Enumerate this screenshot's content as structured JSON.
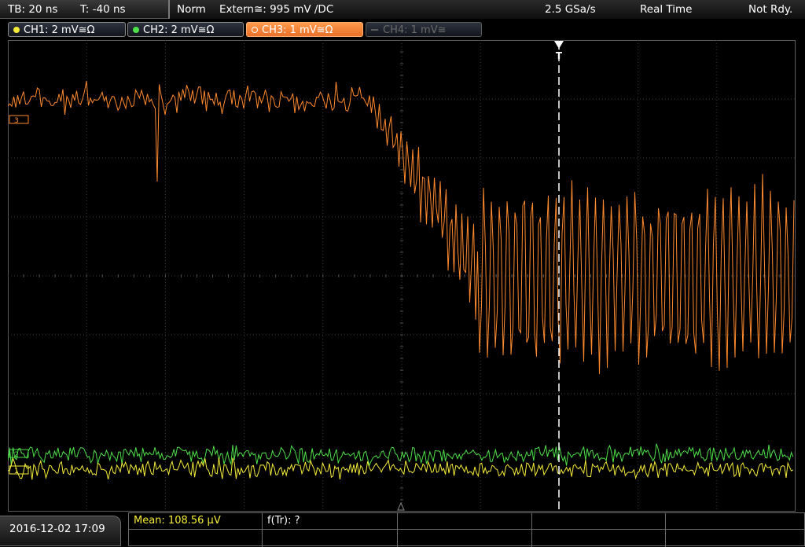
{
  "topbar": {
    "timebase": "TB: 20 ns",
    "trigger_offset": "T: -40 ns",
    "trigger_mode": "Norm",
    "trigger_source": "Extern≅: 995 mV ∕DC",
    "sample_rate": "2.5 GSa/s",
    "acq_mode": "Real Time",
    "status": "Not Rdy."
  },
  "channels": [
    {
      "label": "CH1: 2 mV≅Ω",
      "color": "#f5ec3a",
      "active": true
    },
    {
      "label": "CH2: 2 mV≅Ω",
      "color": "#4ee04a",
      "active": true
    },
    {
      "label": "CH3: 1 mV≅Ω",
      "color": "#f08a3c",
      "active": true
    },
    {
      "label": "CH4: 1 mV≅",
      "color": "#6a6a6a",
      "active": false
    }
  ],
  "markers": {
    "ch3": "3",
    "ch2": "2",
    "ch1": "1",
    "trigger": "T"
  },
  "bottom": {
    "datetime": "2016-12-02 17:09",
    "mean": "Mean: 108.56 µV",
    "ftr": "f(Tr): ?"
  },
  "colors": {
    "ch1": "#f5ec3a",
    "ch2": "#4ee04a",
    "ch3": "#ff8a2e",
    "grid": "#3c3c3c"
  }
}
